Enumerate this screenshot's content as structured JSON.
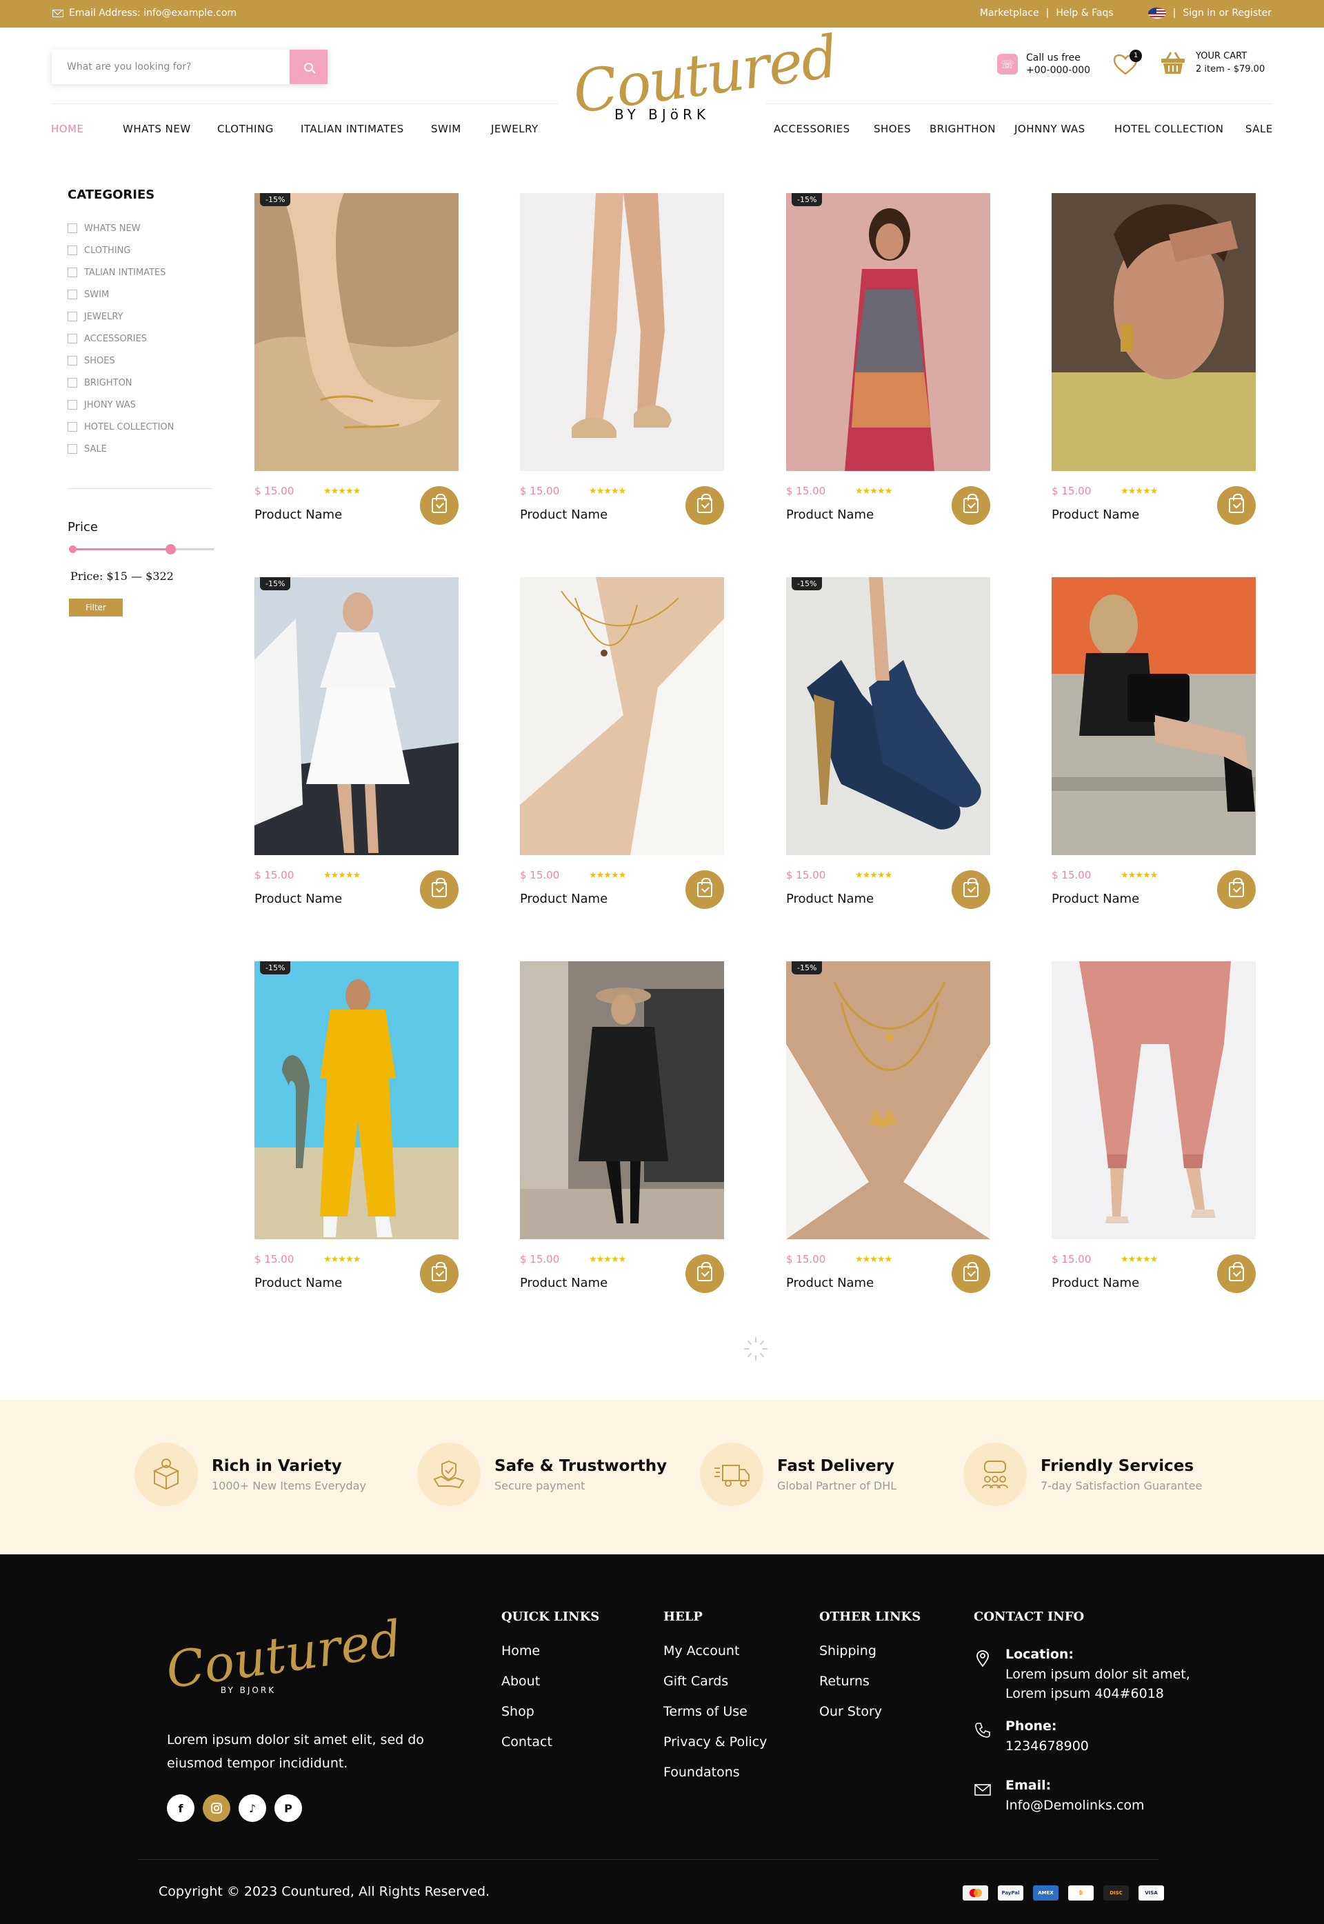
{
  "topbar": {
    "email": "Email Address: info@example.com",
    "marketplace": "Marketplace",
    "help": "Help & Faqs",
    "signin": "Sign in or Register"
  },
  "header": {
    "search_placeholder": "What are you looking for?",
    "logo_script": "Coutured",
    "logo_sub": "BY BJöRK",
    "call_label": "Call us free",
    "call_number": "+00-000-000",
    "wishlist_count": "1",
    "cart_label": "YOUR CART",
    "cart_summary": "2 item - $79.00"
  },
  "nav": {
    "left": [
      "HOME",
      "WHATS NEW",
      "CLOTHING",
      "ITALIAN INTIMATES",
      "SWIM",
      "JEWELRY"
    ],
    "right": [
      "ACCESSORIES",
      "SHOES",
      "BRIGHTHON",
      "JOHNNY WAS",
      "HOTEL COLLECTION",
      "SALE"
    ],
    "active": "HOME"
  },
  "sidebar": {
    "categories_title": "CATEGORIES",
    "categories": [
      "WHATS NEW",
      "CLOTHING",
      "TALIAN INTIMATES",
      "SWIM",
      "JEWELRY",
      "ACCESSORIES",
      "SHOES",
      "BRIGHTON",
      "JHONY WAS",
      "HOTEL COLLECTION",
      "SALE"
    ],
    "price_title": "Price",
    "price_range": "Price: $15 — $322",
    "price_min": 15,
    "price_max": 322,
    "filter_label": "Filter"
  },
  "products": [
    {
      "name": "Product Name",
      "price": "$ 15.00",
      "discount": "-15%",
      "rating": 5,
      "image": "hand-with-rings"
    },
    {
      "name": "Product Name",
      "price": "$ 15.00",
      "discount": "",
      "rating": 5,
      "image": "legs-with-sandals"
    },
    {
      "name": "Product Name",
      "price": "$ 15.00",
      "discount": "-15%",
      "rating": 5,
      "image": "woman-floral-dress"
    },
    {
      "name": "Product Name",
      "price": "$ 15.00",
      "discount": "",
      "rating": 5,
      "image": "woman-earring"
    },
    {
      "name": "Product Name",
      "price": "$ 15.00",
      "discount": "-15%",
      "rating": 5,
      "image": "white-dress"
    },
    {
      "name": "Product Name",
      "price": "$ 15.00",
      "discount": "",
      "rating": 5,
      "image": "necklace-white-shirt"
    },
    {
      "name": "Product Name",
      "price": "$ 15.00",
      "discount": "-15%",
      "rating": 5,
      "image": "navy-heels"
    },
    {
      "name": "Product Name",
      "price": "$ 15.00",
      "discount": "",
      "rating": 5,
      "image": "woman-black-bag"
    },
    {
      "name": "Product Name",
      "price": "$ 15.00",
      "discount": "-15%",
      "rating": 5,
      "image": "yellow-tracksuit"
    },
    {
      "name": "Product Name",
      "price": "$ 15.00",
      "discount": "",
      "rating": 5,
      "image": "black-coat"
    },
    {
      "name": "Product Name",
      "price": "$ 15.00",
      "discount": "-15%",
      "rating": 5,
      "image": "butterfly-necklace"
    },
    {
      "name": "Product Name",
      "price": "$ 15.00",
      "discount": "",
      "rating": 5,
      "image": "pink-joggers"
    }
  ],
  "features": [
    {
      "title": "Rich in Variety",
      "subtitle": "1000+ New Items Everyday",
      "icon": "gift-box-icon"
    },
    {
      "title": "Safe & Trustworthy",
      "subtitle": "Secure payment",
      "icon": "handshake-icon"
    },
    {
      "title": "Fast Delivery",
      "subtitle": "Global Partner of DHL",
      "icon": "truck-icon"
    },
    {
      "title": "Friendly Services",
      "subtitle": "7-day Satisfaction Guarantee",
      "icon": "support-people-icon"
    }
  ],
  "footer": {
    "logo_script": "Coutured",
    "logo_sub": "BY BJORK",
    "about": "Lorem ipsum dolor sit amet elit, sed do eiusmod tempor incididunt.",
    "socials": [
      "facebook",
      "instagram",
      "tiktok",
      "pinterest"
    ],
    "quick_links": {
      "title": "QUICK LINKS",
      "items": [
        "Home",
        "About",
        "Shop",
        "Contact"
      ]
    },
    "help": {
      "title": "HELP",
      "items": [
        "My Account",
        "Gift Cards",
        "Terms of Use",
        "Privacy & Policy",
        "Foundatons"
      ]
    },
    "other_links": {
      "title": "OTHER LINKS",
      "items": [
        "Shipping",
        "Returns",
        "Our Story"
      ]
    },
    "contact": {
      "title": "CONTACT INFO",
      "location_label": "Location:",
      "location_line1": "Lorem ipsum dolor sit amet,",
      "location_line2": "Lorem ipsum 404#6018",
      "phone_label": "Phone:",
      "phone": "1234678900",
      "email_label": "Email:",
      "email": "Info@Demolinks.com"
    },
    "copyright": "Copyright © 2023 Countured, All Rights Reserved.",
    "payments": [
      "mastercard",
      "paypal",
      "amex",
      "bitcoin",
      "discover",
      "visa"
    ]
  },
  "colors": {
    "gold": "#c29a46",
    "pink": "#f083a8",
    "cream": "#fdf5e4",
    "dark": "#0c0c0c"
  }
}
